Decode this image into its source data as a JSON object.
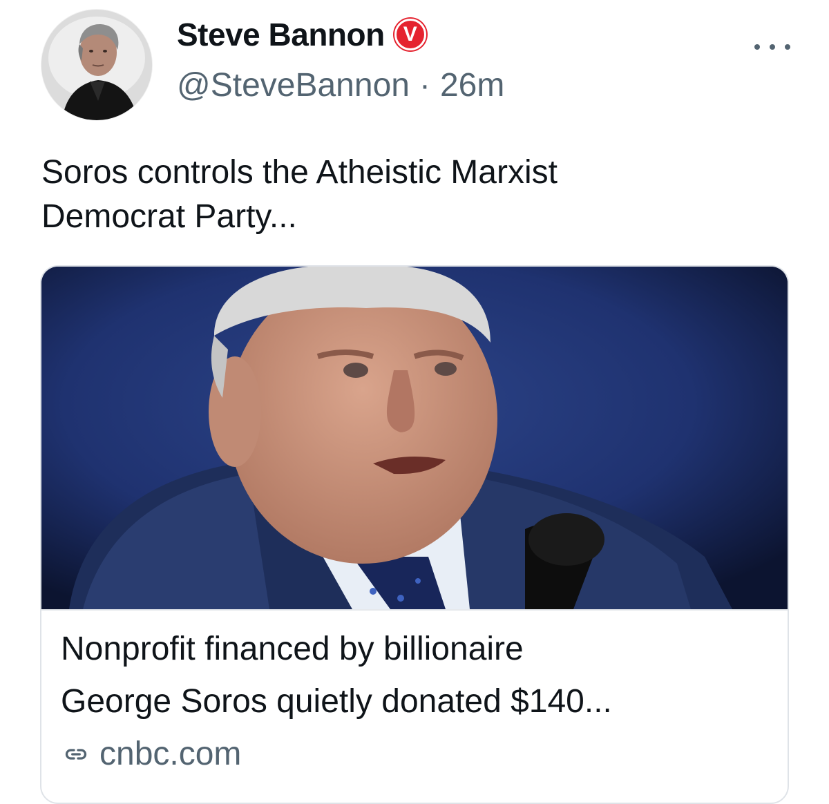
{
  "author": {
    "display_name": "Steve Bannon",
    "verified_badge": "V",
    "handle": "@SteveBannon",
    "separator": "·",
    "time": "26m"
  },
  "tweet": {
    "text": "Soros controls the Atheistic Marxist\nDemocrat Party..."
  },
  "link_card": {
    "title": "Nonprofit financed by billionaire\nGeorge Soros quietly donated $140...",
    "source": "cnbc.com"
  },
  "icons": {
    "more": "more-horizontal-icon",
    "link": "link-icon",
    "verified": "verified-badge-icon"
  },
  "colors": {
    "badge": "#e5232f",
    "secondary_text": "#536471",
    "primary_text": "#0f1419",
    "card_border": "#dfe3e8"
  }
}
